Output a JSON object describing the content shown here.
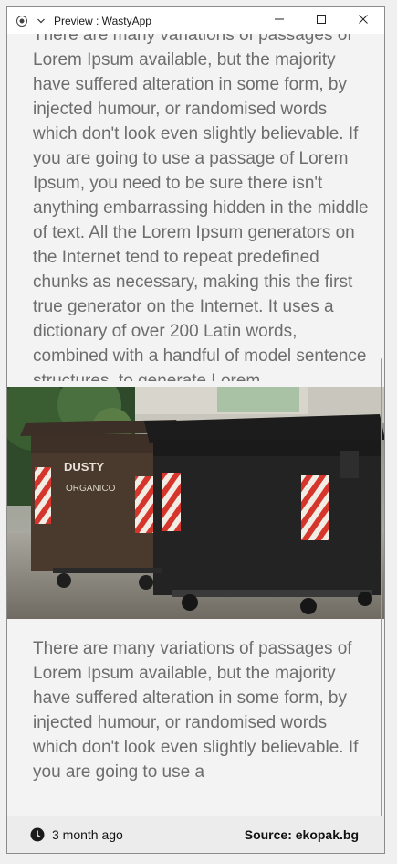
{
  "window": {
    "title": "Preview : WastyApp",
    "app_icon": "record-icon",
    "menu_icon": "chevron-down-icon",
    "controls": [
      "minimize-icon",
      "maximize-icon",
      "close-icon"
    ]
  },
  "article": {
    "paragraph_top": "There are many variations of passages of Lorem Ipsum available, but the majority have suffered alteration in some form, by injected humour, or randomised words which don't look even slightly believable. If you are going to use a passage of Lorem Ipsum, you need to be sure there isn't anything embarrassing hidden in the middle of text. All the Lorem Ipsum generators on the Internet tend to repeat predefined chunks as necessary, making this the first true generator on the Internet. It uses a dictionary of over 200 Latin words, combined with a handful of model sentence structures, to generate Lorem",
    "image": {
      "brand_text": "DUSTY",
      "sub_text": "ORGANICO"
    },
    "paragraph_bottom": "There are many variations of passages of Lorem Ipsum available, but the majority have suffered alteration in some form, by injected humour, or randomised words which don't look even slightly believable. If you are going to use a"
  },
  "footer": {
    "time_icon": "clock-icon",
    "age": "3 month ago",
    "source": "Source: ekopak.bg"
  },
  "colors": {
    "text": "#6d6d6d",
    "footer_bg": "#ececec",
    "page_bg": "#f3f3f3"
  }
}
